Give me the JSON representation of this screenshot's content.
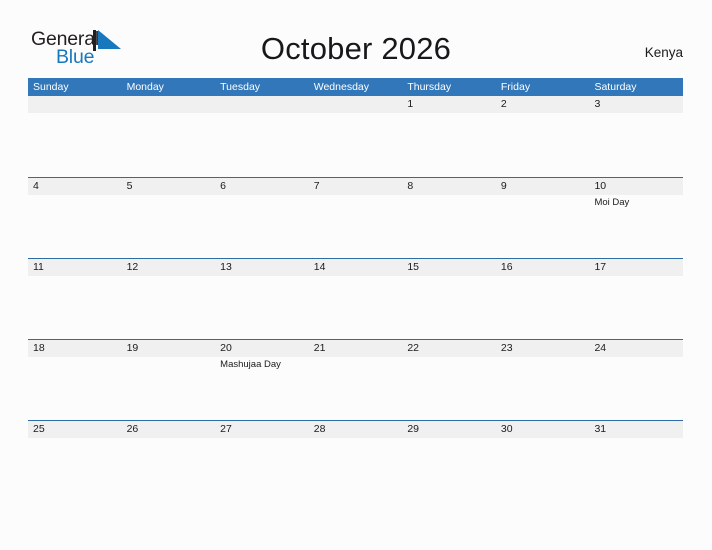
{
  "brand": {
    "name_part1": "General",
    "name_part2": "Blue",
    "triangle_color": "#1878be"
  },
  "header": {
    "title": "October 2026",
    "country": "Kenya"
  },
  "colors": {
    "header_blue": "#3277b9",
    "row_separator_blue": "#2e6da4",
    "date_band_gray": "#f0f0f0",
    "page_background": "#fcfcfd",
    "text": "#1b1b1d"
  },
  "weekdays": [
    "Sunday",
    "Monday",
    "Tuesday",
    "Wednesday",
    "Thursday",
    "Friday",
    "Saturday"
  ],
  "weeks": [
    {
      "days": [
        {
          "date": "",
          "event": ""
        },
        {
          "date": "",
          "event": ""
        },
        {
          "date": "",
          "event": ""
        },
        {
          "date": "",
          "event": ""
        },
        {
          "date": "1",
          "event": ""
        },
        {
          "date": "2",
          "event": ""
        },
        {
          "date": "3",
          "event": ""
        }
      ]
    },
    {
      "days": [
        {
          "date": "4",
          "event": ""
        },
        {
          "date": "5",
          "event": ""
        },
        {
          "date": "6",
          "event": ""
        },
        {
          "date": "7",
          "event": ""
        },
        {
          "date": "8",
          "event": ""
        },
        {
          "date": "9",
          "event": ""
        },
        {
          "date": "10",
          "event": "Moi Day"
        }
      ]
    },
    {
      "days": [
        {
          "date": "11",
          "event": ""
        },
        {
          "date": "12",
          "event": ""
        },
        {
          "date": "13",
          "event": ""
        },
        {
          "date": "14",
          "event": ""
        },
        {
          "date": "15",
          "event": ""
        },
        {
          "date": "16",
          "event": ""
        },
        {
          "date": "17",
          "event": ""
        }
      ]
    },
    {
      "days": [
        {
          "date": "18",
          "event": ""
        },
        {
          "date": "19",
          "event": ""
        },
        {
          "date": "20",
          "event": "Mashujaa Day"
        },
        {
          "date": "21",
          "event": ""
        },
        {
          "date": "22",
          "event": ""
        },
        {
          "date": "23",
          "event": ""
        },
        {
          "date": "24",
          "event": ""
        }
      ]
    },
    {
      "days": [
        {
          "date": "25",
          "event": ""
        },
        {
          "date": "26",
          "event": ""
        },
        {
          "date": "27",
          "event": ""
        },
        {
          "date": "28",
          "event": ""
        },
        {
          "date": "29",
          "event": ""
        },
        {
          "date": "30",
          "event": ""
        },
        {
          "date": "31",
          "event": ""
        }
      ]
    }
  ]
}
